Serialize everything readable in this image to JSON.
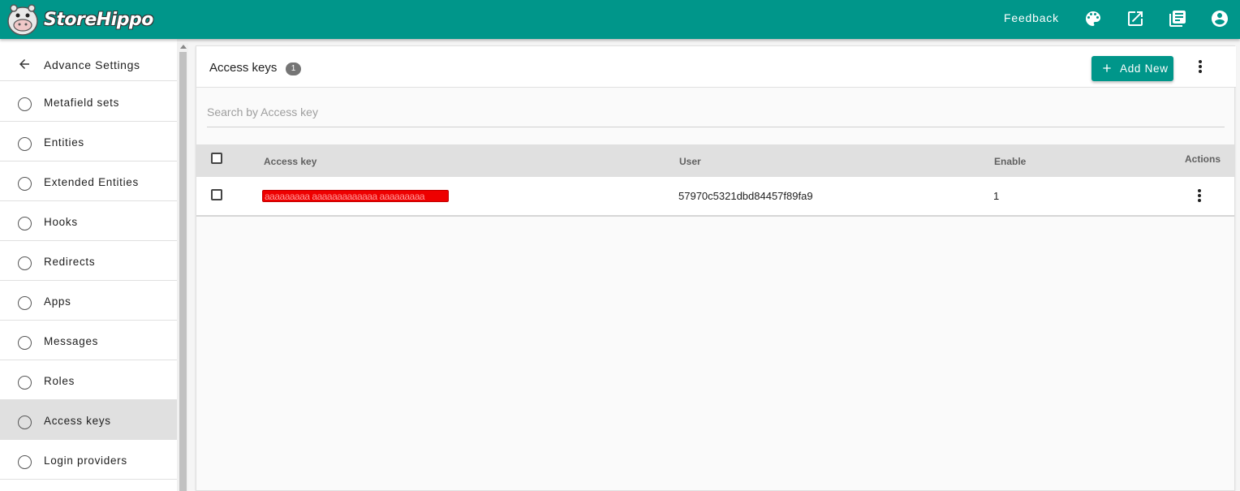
{
  "app": {
    "brand": "StoreHippo",
    "brand_color": "#00968a"
  },
  "topbar": {
    "feedback_label": "Feedback",
    "icons": [
      "palette-icon",
      "open-in-new-icon",
      "library-books-icon",
      "account-circle-icon"
    ]
  },
  "sidebar": {
    "title": "Advance Settings",
    "back_icon": "arrow-back-icon",
    "items": [
      {
        "label": "Metafield sets",
        "active": false
      },
      {
        "label": "Entities",
        "active": false
      },
      {
        "label": "Extended Entities",
        "active": false
      },
      {
        "label": "Hooks",
        "active": false
      },
      {
        "label": "Redirects",
        "active": false
      },
      {
        "label": "Apps",
        "active": false
      },
      {
        "label": "Messages",
        "active": false
      },
      {
        "label": "Roles",
        "active": false
      },
      {
        "label": "Access keys",
        "active": true
      },
      {
        "label": "Login providers",
        "active": false
      }
    ]
  },
  "main": {
    "title": "Access keys",
    "count": "1",
    "add_button_label": "Add New",
    "search_placeholder": "Search by Access key",
    "search_value": "",
    "table": {
      "columns": [
        "Access key",
        "User",
        "Enable",
        "Actions"
      ],
      "rows": [
        {
          "access_key": "aaaaaaaaa aaaaaaaaaaaaa aaaaaaaaa",
          "access_key_redacted": true,
          "user": "57970c5321dbd84457f89fa9",
          "enable": "1"
        }
      ]
    }
  }
}
